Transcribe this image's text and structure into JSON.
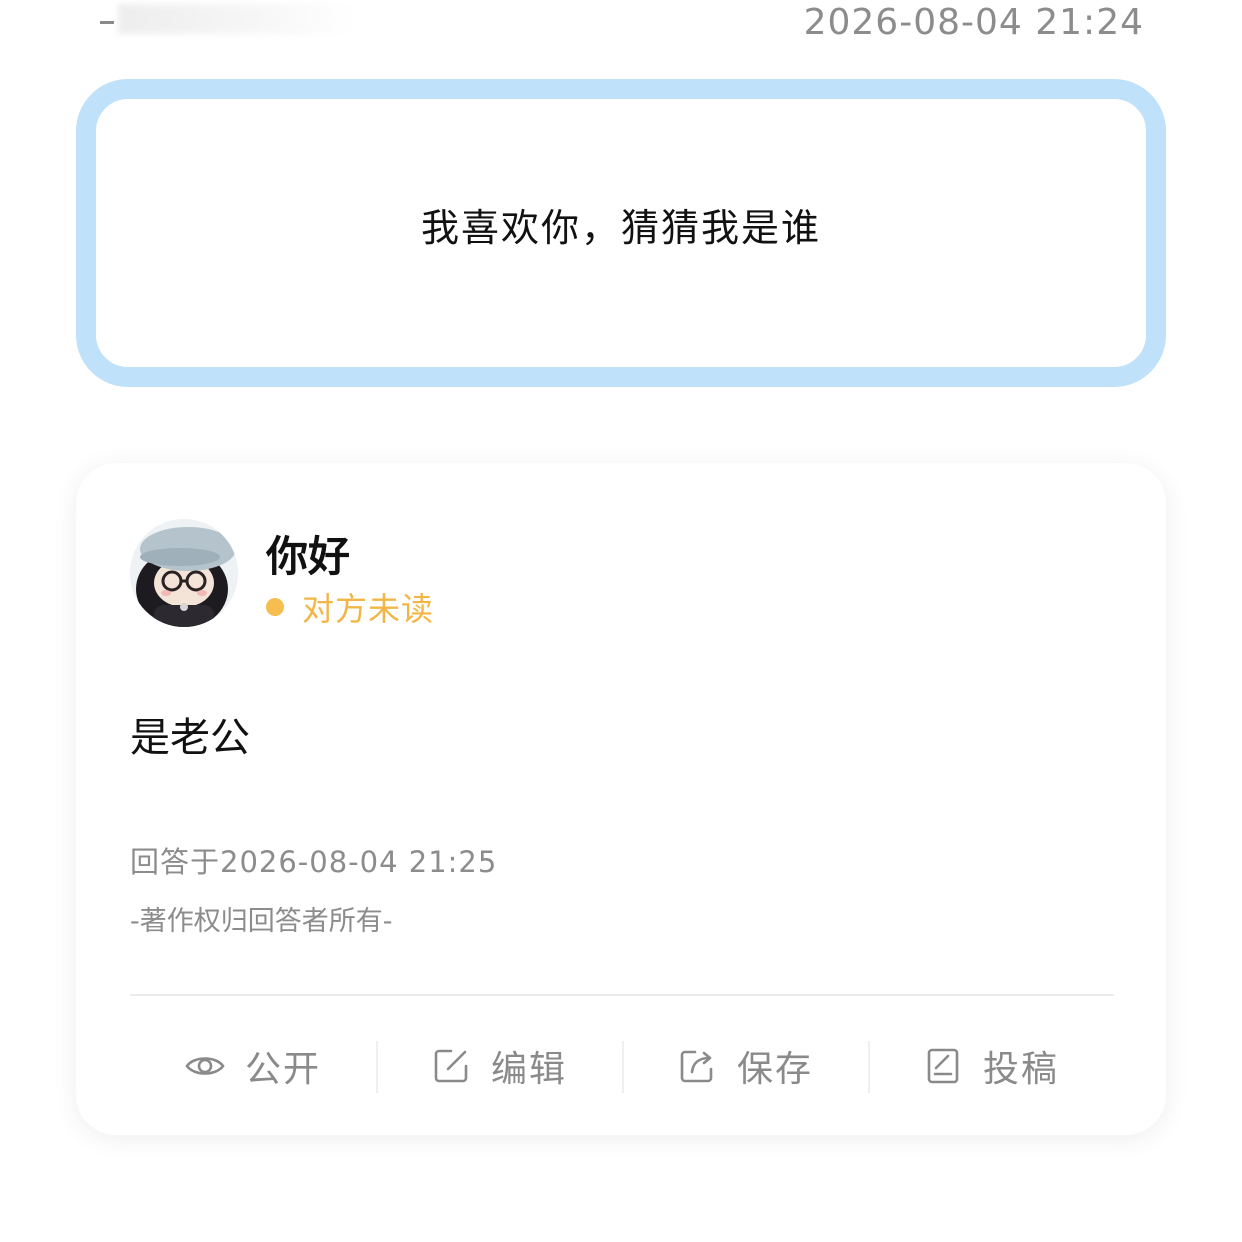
{
  "header": {
    "timestamp": "2026-08-04 21:24"
  },
  "question": {
    "text": "我喜欢你，猜猜我是谁"
  },
  "answer": {
    "nickname": "你好",
    "status": "对方未读",
    "status_color": "#f6bd4f",
    "content": "是老公",
    "answered_at": "回答于2026-08-04 21:25",
    "copyright": "-著作权归回答者所有-"
  },
  "actions": [
    {
      "label": "公开",
      "icon": "eye-icon"
    },
    {
      "label": "编辑",
      "icon": "edit-icon"
    },
    {
      "label": "保存",
      "icon": "share-icon"
    },
    {
      "label": "投稿",
      "icon": "document-icon"
    }
  ],
  "colors": {
    "question_border": "#bfe1fa",
    "muted_text": "#8c8c8c"
  }
}
